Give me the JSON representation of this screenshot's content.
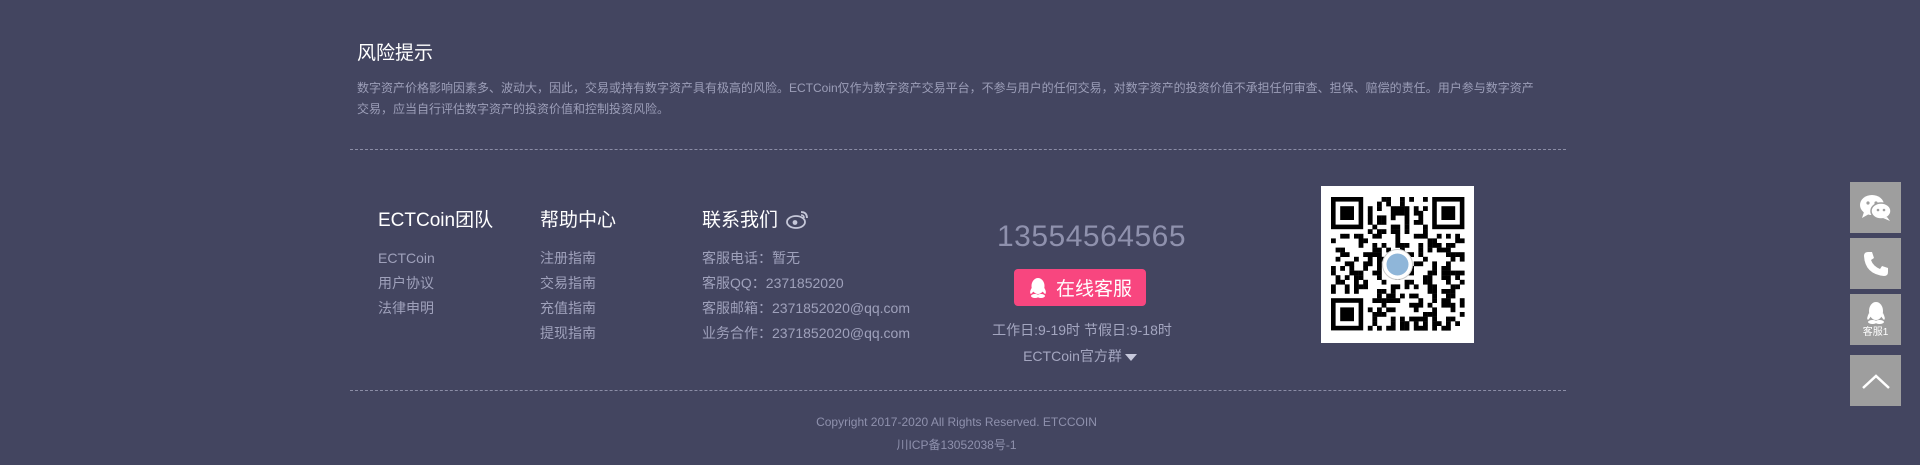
{
  "risk": {
    "title": "风险提示",
    "text_line1": " 数字资产价格影响因素多、波动大，因此，交易或持有数字资产具有极高的风险。ECTCoin仅作为数字资产交易平台，不参与用户的任何交易，对数字资产的投资价值不承担任何审查、担保、赔偿的责任。用户参与数字资产",
    "text_line2": "交易，应当自行评估数字资产的投资价值和控制投资风险。"
  },
  "team": {
    "title": "ECTCoin团队",
    "items": [
      "ECTCoin",
      "用户协议",
      "法律申明"
    ]
  },
  "help": {
    "title": "帮助中心",
    "items": [
      "注册指南",
      "交易指南",
      "充值指南",
      "提现指南"
    ]
  },
  "contact": {
    "title": "联系我们",
    "items": [
      "客服电话：暂无",
      "客服QQ：2371852020",
      "客服邮箱：2371852020@qq.com",
      "业务合作：2371852020@qq.com"
    ]
  },
  "service": {
    "phone": "13554564565",
    "online_label": "在线客服",
    "hours": "工作日:9-19时 节假日:9-18时",
    "group_label": "ECTCoin官方群"
  },
  "footer": {
    "copyright": "Copyright 2017-2020 All Rights Reserved. ETCCOIN",
    "icp": "川ICP备13052038号-1"
  },
  "sidebar": {
    "qq_label": "客服1"
  },
  "colors": {
    "background": "#434560",
    "accent": "#f8467f",
    "side_button": "#9e9e9e"
  }
}
